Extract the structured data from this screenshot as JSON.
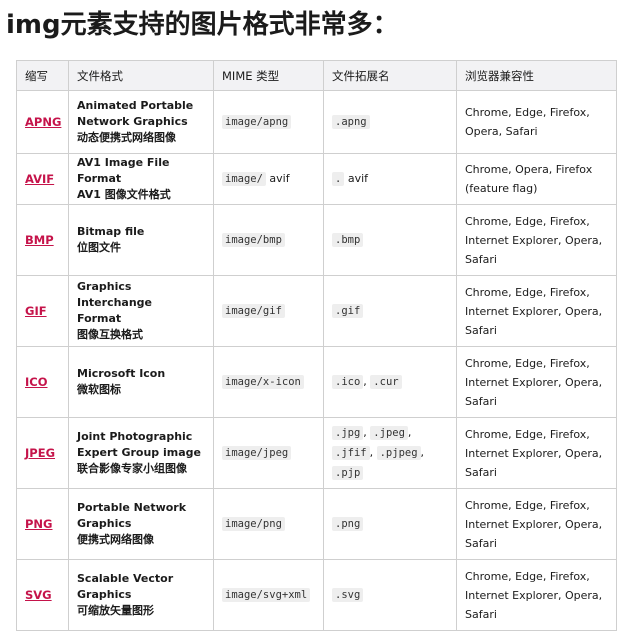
{
  "heading": "img元素支持的图片格式非常多：",
  "table": {
    "headers": [
      "缩写",
      "文件格式",
      "MIME 类型",
      "文件拓展名",
      "浏览器兼容性"
    ],
    "rows": [
      {
        "abbr": "APNG",
        "format": [
          "Animated Portable",
          "Network Graphics",
          "动态便携式网络图像"
        ],
        "mime_code": "image/apng",
        "mime_plain": "",
        "ext": [
          ".apng"
        ],
        "ext_plain": "",
        "browsers": [
          "Chrome, Edge, Firefox,",
          "Opera, Safari"
        ],
        "height": 63
      },
      {
        "abbr": "AVIF",
        "format": [
          "AV1 Image File Format",
          "AV1 图像文件格式"
        ],
        "mime_code": "image/",
        "mime_plain": " avif",
        "ext": [
          "."
        ],
        "ext_plain": " avif",
        "browsers": [
          "Chrome, Opera, Firefox",
          "(feature flag)"
        ],
        "height": 51
      },
      {
        "abbr": "BMP",
        "format": [
          "Bitmap file",
          "位图文件"
        ],
        "mime_code": "image/bmp",
        "mime_plain": "",
        "ext": [
          ".bmp"
        ],
        "ext_plain": "",
        "browsers": [
          "Chrome, Edge, Firefox,",
          "Internet Explorer, Opera,",
          "Safari"
        ],
        "height": 71
      },
      {
        "abbr": "GIF",
        "format": [
          "Graphics Interchange",
          "Format",
          "图像互换格式"
        ],
        "mime_code": "image/gif",
        "mime_plain": "",
        "ext": [
          ".gif"
        ],
        "ext_plain": "",
        "browsers": [
          "Chrome, Edge, Firefox,",
          "Internet Explorer, Opera,",
          "Safari"
        ],
        "height": 71
      },
      {
        "abbr": "ICO",
        "format": [
          "Microsoft Icon",
          "微软图标"
        ],
        "mime_code": "image/x-icon",
        "mime_plain": "",
        "ext": [
          ".ico",
          ".cur"
        ],
        "ext_plain": "",
        "browsers": [
          "Chrome, Edge, Firefox,",
          "Internet Explorer, Opera,",
          "Safari"
        ],
        "height": 71
      },
      {
        "abbr": "JPEG",
        "format": [
          "Joint Photographic",
          "Expert Group image",
          "联合影像专家小组图像"
        ],
        "mime_code": "image/jpeg",
        "mime_plain": "",
        "ext": [
          ".jpg",
          ".jpeg",
          ".jfif",
          ".pjpeg",
          ".pjp"
        ],
        "ext_plain": "",
        "browsers": [
          "Chrome, Edge, Firefox,",
          "Internet Explorer, Opera,",
          "Safari"
        ],
        "height": 71
      },
      {
        "abbr": "PNG",
        "format": [
          "Portable Network",
          "Graphics",
          "便携式网络图像"
        ],
        "mime_code": "image/png",
        "mime_plain": "",
        "ext": [
          ".png"
        ],
        "ext_plain": "",
        "browsers": [
          "Chrome, Edge, Firefox,",
          "Internet Explorer, Opera,",
          "Safari"
        ],
        "height": 71
      },
      {
        "abbr": "SVG",
        "format": [
          "Scalable Vector",
          "Graphics",
          "可缩放矢量图形"
        ],
        "mime_code": "image/svg+xml",
        "mime_plain": "",
        "ext": [
          ".svg"
        ],
        "ext_plain": "",
        "browsers": [
          "Chrome, Edge, Firefox,",
          "Internet Explorer, Opera,",
          "Safari"
        ],
        "height": 71
      }
    ]
  },
  "colors": {
    "link": "#c5134a",
    "header_bg": "#f2f2f4",
    "border": "#cfcfcf",
    "code_bg": "#eeeeee"
  }
}
